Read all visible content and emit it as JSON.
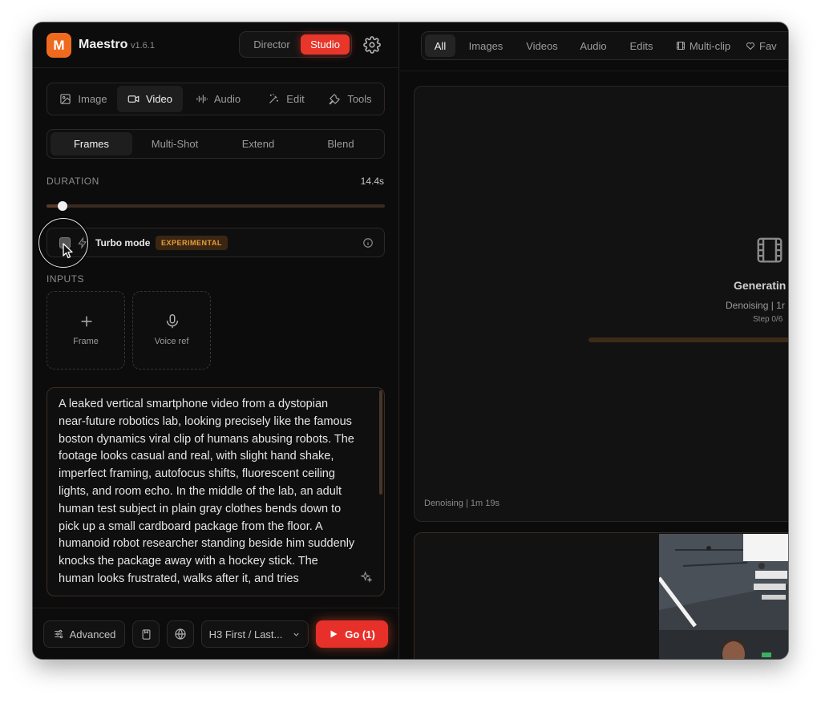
{
  "app": {
    "logo_letter": "M",
    "name": "Maestro",
    "version": "v1.6.1"
  },
  "mode": {
    "director": "Director",
    "studio": "Studio"
  },
  "main_tabs": [
    {
      "label": "Image",
      "icon": "image-icon"
    },
    {
      "label": "Video",
      "icon": "video-icon",
      "active": true
    },
    {
      "label": "Audio",
      "icon": "audio-wave-icon"
    },
    {
      "label": "Edit",
      "icon": "magic-wand-icon"
    },
    {
      "label": "Tools",
      "icon": "wrench-icon"
    }
  ],
  "sub_tabs": [
    {
      "label": "Frames",
      "active": true
    },
    {
      "label": "Multi-Shot"
    },
    {
      "label": "Extend"
    },
    {
      "label": "Blend"
    }
  ],
  "duration": {
    "label": "DURATION",
    "value": "14.4s",
    "fraction": 0.05
  },
  "turbo": {
    "label": "Turbo mode",
    "badge": "EXPERIMENTAL",
    "checked": false
  },
  "inputs": {
    "label": "INPUTS",
    "tiles": [
      {
        "label": "Frame",
        "icon": "plus-icon"
      },
      {
        "label": "Voice ref",
        "icon": "microphone-icon"
      }
    ]
  },
  "prompt": {
    "text": "A leaked vertical smartphone video from a dystopian near-future robotics lab, looking precisely like the famous boston dynamics viral clip of humans abusing robots. The footage looks casual and real, with slight hand shake, imperfect framing, autofocus shifts, fluorescent ceiling lights, and room echo. In the middle of the lab, an adult human test subject in plain gray clothes bends down to pick up a small cardboard package from the floor. A humanoid robot researcher standing beside him suddenly knocks the package away with a hockey stick. The human looks frustrated, walks after it, and tries"
  },
  "bottom": {
    "advanced": "Advanced",
    "model_select": "H3 First / Last...",
    "go": "Go (1)"
  },
  "filters": [
    {
      "label": "All",
      "active": true
    },
    {
      "label": "Images"
    },
    {
      "label": "Videos"
    },
    {
      "label": "Audio"
    },
    {
      "label": "Edits"
    },
    {
      "label": "Multi-clip",
      "icon": "film-icon"
    },
    {
      "label": "Fav",
      "icon": "heart-icon"
    }
  ],
  "generation": {
    "title": "Generatin",
    "status": "Denoising | 1r",
    "step": "Step 0/6",
    "progress": 0.0,
    "footer": "Denoising | 1m 19s"
  },
  "colors": {
    "accent": "#ef6a1f",
    "studio_active": "#e8362a",
    "go_button": "#e8302a",
    "progress": "#b08a2e",
    "badge_text": "#e8a03a"
  }
}
